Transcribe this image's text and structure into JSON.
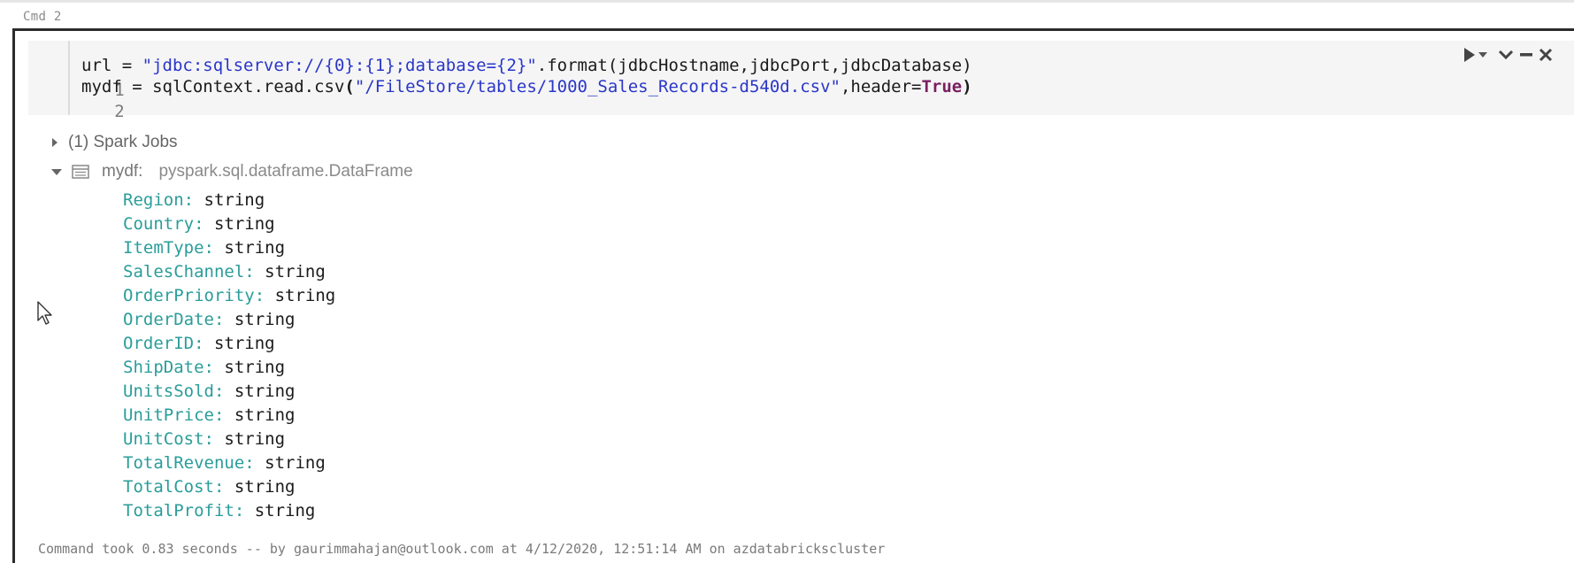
{
  "cmd_label": "Cmd 2",
  "code_lines": [
    {
      "number": "1",
      "segments": [
        {
          "t": "url = ",
          "c": "plain"
        },
        {
          "t": "\"jdbc:sqlserver://{0}:{1};database={2}\"",
          "c": "str"
        },
        {
          "t": ".format(jdbcHostname,jdbcPort,jdbcDatabase)",
          "c": "plain"
        }
      ]
    },
    {
      "number": "2",
      "segments": [
        {
          "t": "mydf = sqlContext.read.csv",
          "c": "plain"
        },
        {
          "t": "(",
          "c": "paren"
        },
        {
          "t": "\"/FileStore/tables/1000_Sales_Records-d540d.csv\"",
          "c": "str"
        },
        {
          "t": ",header=",
          "c": "plain"
        },
        {
          "t": "True",
          "c": "kw"
        },
        {
          "t": ")",
          "c": "paren"
        }
      ]
    }
  ],
  "spark_jobs_label": "(1) Spark Jobs",
  "dataframe": {
    "name": "mydf:",
    "type": "pyspark.sql.dataframe.DataFrame"
  },
  "schema_fields": [
    {
      "name": "Region",
      "type": "string"
    },
    {
      "name": "Country",
      "type": "string"
    },
    {
      "name": "ItemType",
      "type": "string"
    },
    {
      "name": "SalesChannel",
      "type": "string"
    },
    {
      "name": "OrderPriority",
      "type": "string"
    },
    {
      "name": "OrderDate",
      "type": "string"
    },
    {
      "name": "OrderID",
      "type": "string"
    },
    {
      "name": "ShipDate",
      "type": "string"
    },
    {
      "name": "UnitsSold",
      "type": "string"
    },
    {
      "name": "UnitPrice",
      "type": "string"
    },
    {
      "name": "UnitCost",
      "type": "string"
    },
    {
      "name": "TotalRevenue",
      "type": "string"
    },
    {
      "name": "TotalCost",
      "type": "string"
    },
    {
      "name": "TotalProfit",
      "type": "string"
    }
  ],
  "footer_text": "Command took 0.83 seconds -- by gaurimmahajan@outlook.com at 4/12/2020, 12:51:14 AM on azdatabrickscluster",
  "icons": {
    "run": "play-icon",
    "run_menu": "caret-down-icon",
    "collapse": "chevron-down-icon",
    "minimize": "minus-icon",
    "close": "close-icon",
    "expand_jobs": "triangle-right-icon",
    "expand_df": "triangle-down-icon",
    "table": "table-icon",
    "cursor": "mouse-pointer-icon"
  },
  "colors": {
    "string_literal": "#2a36c9",
    "keyword": "#7a1f60",
    "schema_field": "#2a9d9a",
    "cell_border": "#2b2b2b",
    "editor_bg": "#f5f5f5"
  }
}
